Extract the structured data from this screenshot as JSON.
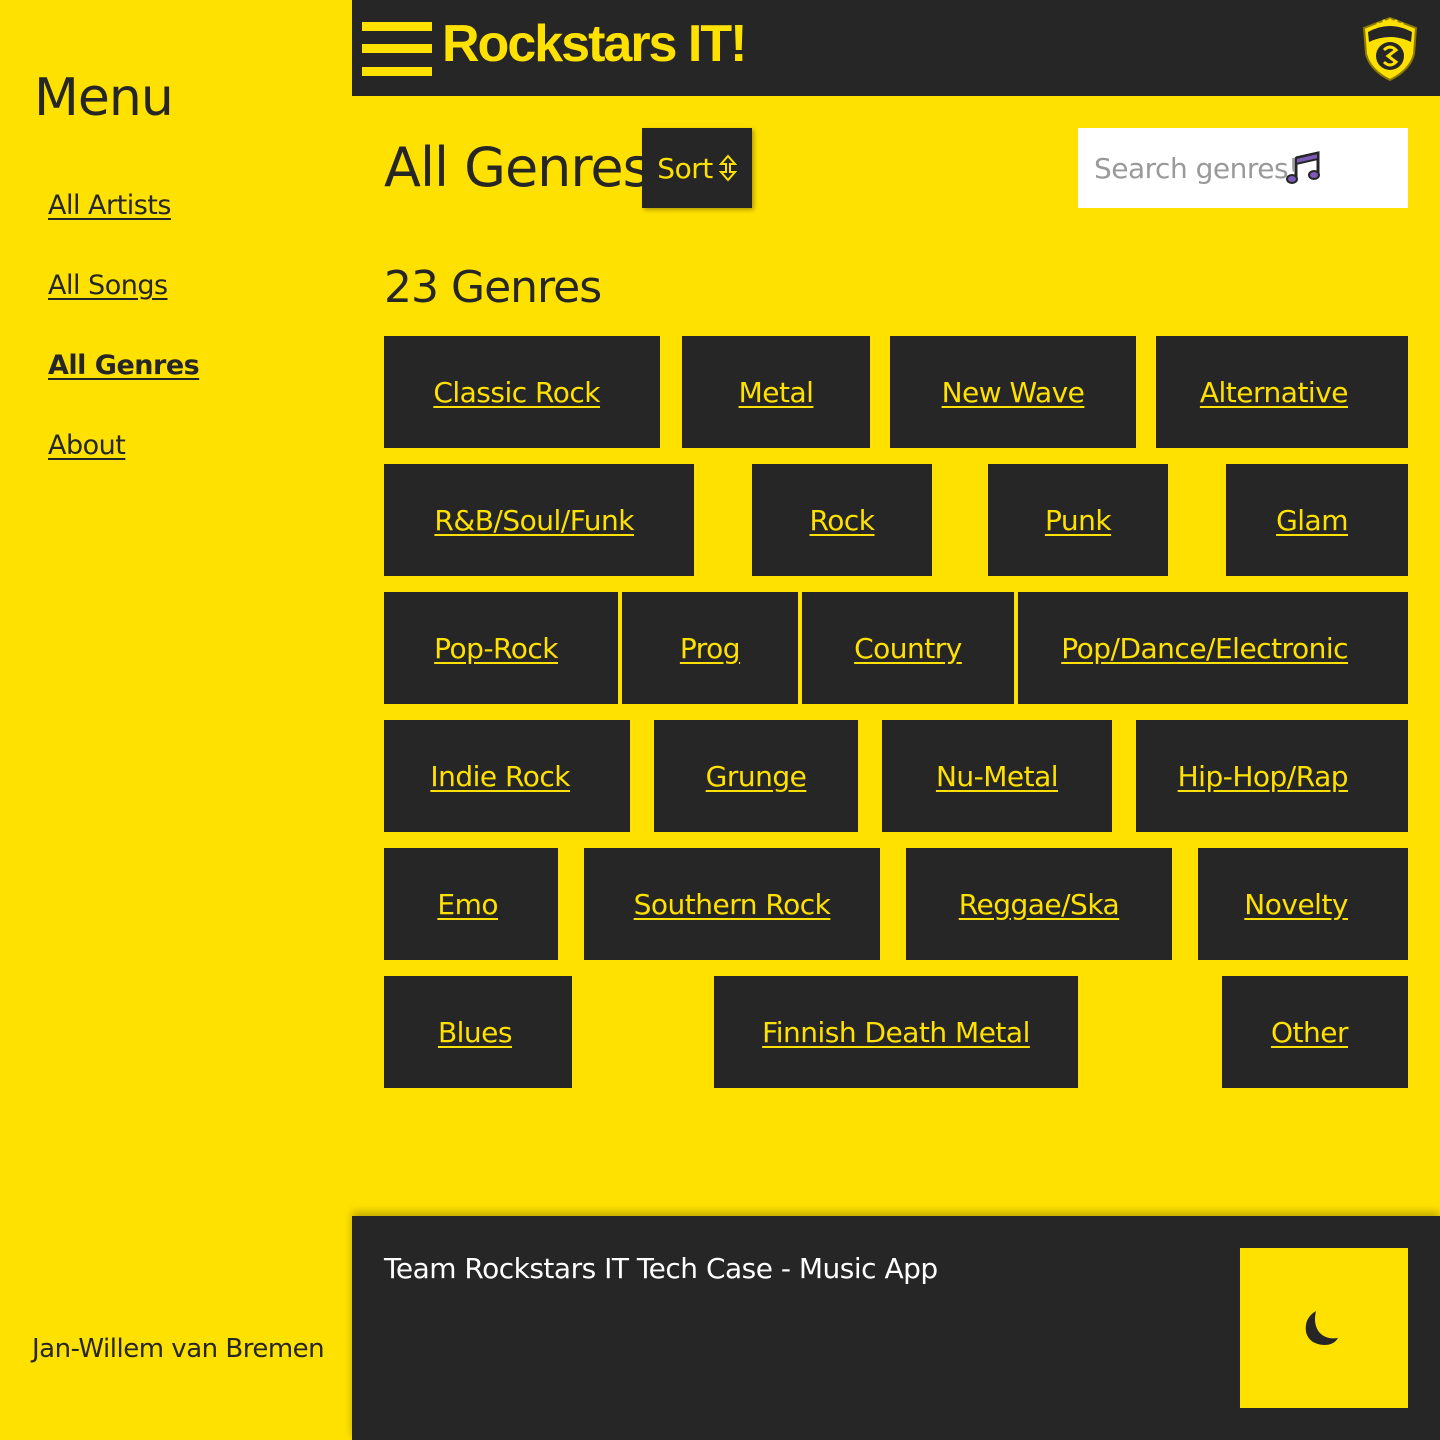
{
  "sidebar": {
    "title": "Menu",
    "items": [
      {
        "label": "All Artists",
        "active": false
      },
      {
        "label": "All Songs",
        "active": false
      },
      {
        "label": "All Genres",
        "active": true
      },
      {
        "label": "About",
        "active": false
      }
    ],
    "author": "Jan-Willem van Bremen"
  },
  "header": {
    "brand": "Rockstars IT!",
    "menu_icon": "hamburger-icon",
    "logo_icon": "rockstars-badge-logo"
  },
  "main": {
    "title": "All Genres",
    "sort_label": "Sort",
    "sort_icon": "sort-arrows-icon",
    "search_placeholder": "Search genres!",
    "search_icon": "music-note-icon",
    "count_label": "23 Genres",
    "genres": [
      "Classic Rock",
      "Metal",
      "New Wave",
      "Alternative",
      "R&B/Soul/Funk",
      "Rock",
      "Punk",
      "Glam",
      "Pop-Rock",
      "Prog",
      "Country",
      "Pop/Dance/Electronic",
      "Indie Rock",
      "Grunge",
      "Nu-Metal",
      "Hip-Hop/Rap",
      "Emo",
      "Southern Rock",
      "Reggae/Ska",
      "Novelty",
      "Blues",
      "Finnish Death Metal",
      "Other"
    ]
  },
  "footer": {
    "text": "Team Rockstars IT Tech Case - Music App",
    "theme_icon": "moon-icon"
  },
  "colors": {
    "accent": "#FFE100",
    "dark": "#262626",
    "note_icon": "#7B5BB5"
  }
}
